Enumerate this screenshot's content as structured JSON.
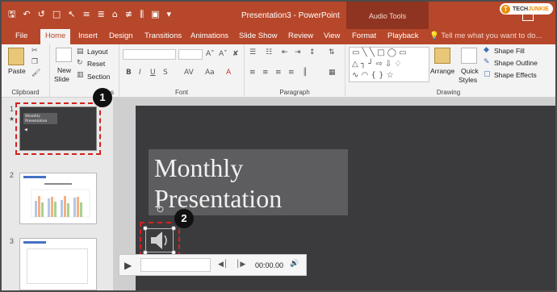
{
  "window": {
    "title": "Presentation3 - PowerPoint",
    "context_group": "Audio Tools",
    "logo_text_a": "TECH",
    "logo_text_b": "JUNKIE",
    "logo_badge": "T"
  },
  "tabs": [
    "File",
    "Home",
    "Insert",
    "Design",
    "Transitions",
    "Animations",
    "Slide Show",
    "Review",
    "View",
    "Format",
    "Playback"
  ],
  "tell_me": "Tell me what you want to do...",
  "ribbon": {
    "clipboard": {
      "paste": "Paste",
      "label": "Clipboard"
    },
    "slides": {
      "new_slide_1": "New",
      "new_slide_2": "Slide",
      "layout": "Layout",
      "reset": "Reset",
      "section": "Section",
      "label": "Slides"
    },
    "font": {
      "label": "Font"
    },
    "paragraph": {
      "label": "Paragraph"
    },
    "drawing": {
      "arrange": "Arrange",
      "quick_styles_1": "Quick",
      "quick_styles_2": "Styles",
      "shape_fill": "Shape Fill",
      "shape_outline": "Shape Outline",
      "shape_effects": "Shape Effects",
      "label": "Drawing"
    }
  },
  "slides": [
    {
      "number": "1",
      "title": "Monthly Presentation"
    },
    {
      "number": "2"
    },
    {
      "number": "3"
    }
  ],
  "slide": {
    "title_line1": "Monthly",
    "title_line2": "Presentation"
  },
  "callouts": [
    "1",
    "2"
  ],
  "player": {
    "time": "00:00.00"
  },
  "colors": {
    "accent": "#b7472a",
    "callout_border": "#d3221e"
  }
}
